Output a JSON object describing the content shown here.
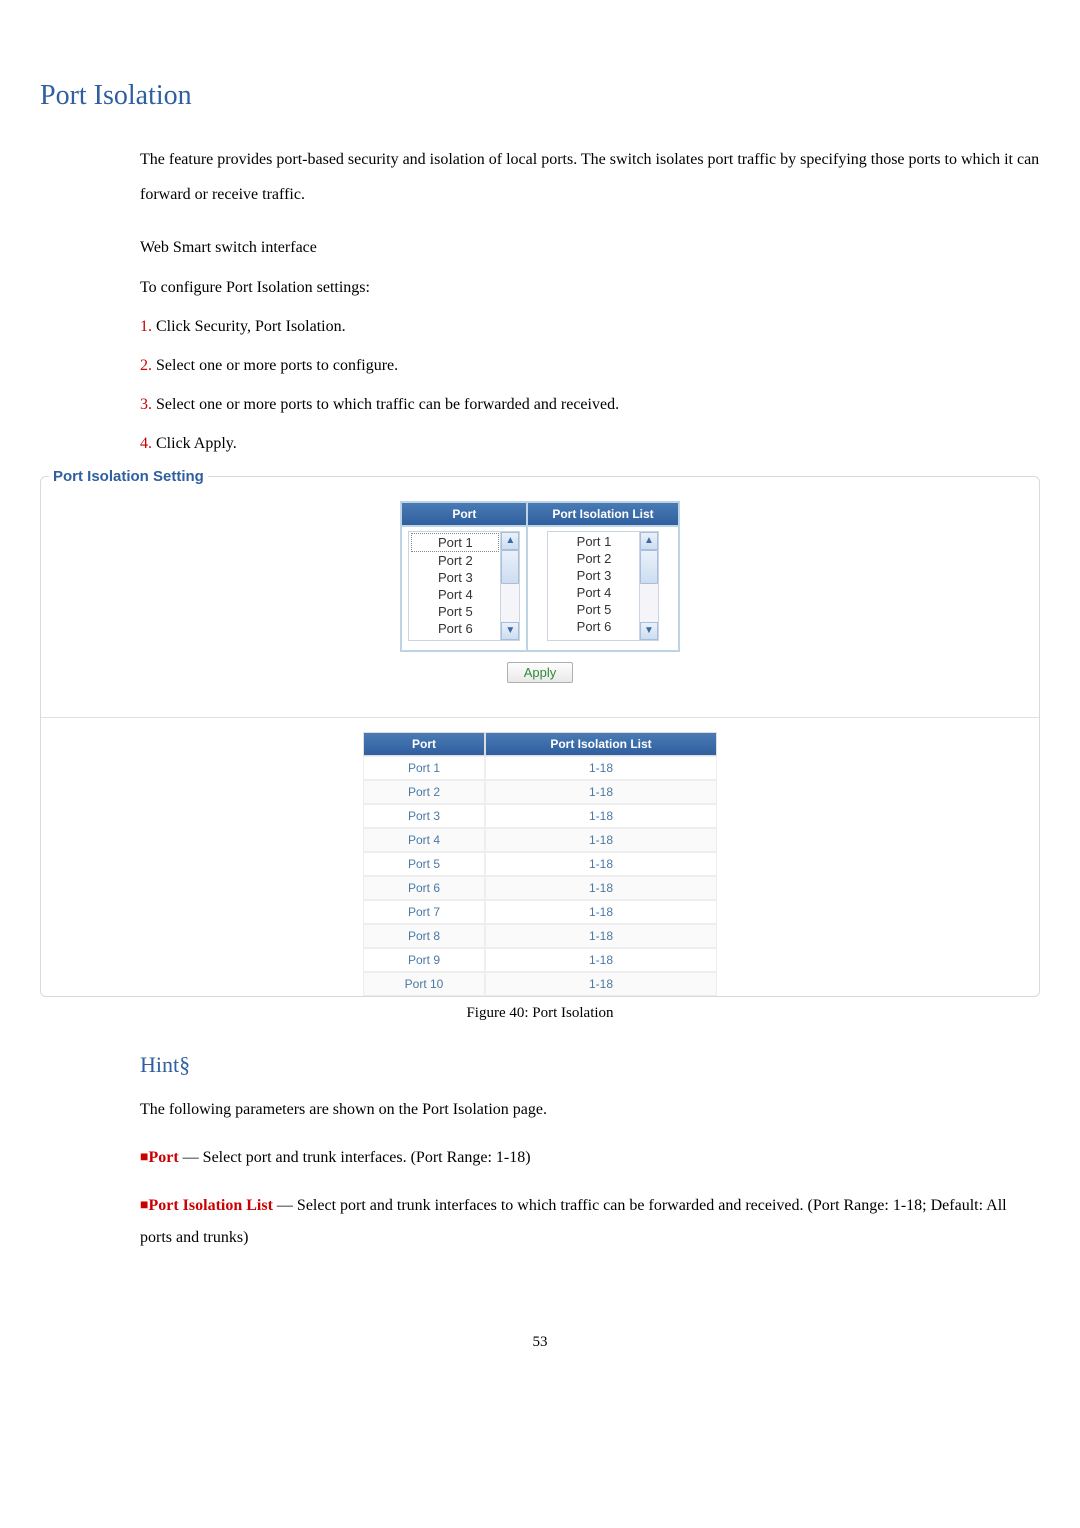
{
  "title": "Port Isolation",
  "intro1": "The feature provides port-based security and isolation of local ports. The switch isolates port traffic by specifying those ports to which it can forward or receive traffic.",
  "web_intf": "Web Smart switch interface",
  "config_line": "To configure Port Isolation settings:",
  "steps": [
    {
      "n": "1.",
      "t": " Click Security, Port Isolation."
    },
    {
      "n": "2.",
      "t": " Select one or more ports to configure."
    },
    {
      "n": "3.",
      "t": " Select one or more ports to which traffic can be forwarded and received."
    },
    {
      "n": "4.",
      "t": " Click Apply."
    }
  ],
  "legend": "Port Isolation Setting",
  "panel": {
    "col1": "Port",
    "col2": "Port Isolation List",
    "port_options": [
      "Port 1",
      "Port 2",
      "Port 3",
      "Port 4",
      "Port 5",
      "Port 6"
    ],
    "iso_options": [
      "Port 1",
      "Port 2",
      "Port 3",
      "Port 4",
      "Port 5",
      "Port 6"
    ],
    "apply": "Apply"
  },
  "results": {
    "h1": "Port",
    "h2": "Port Isolation List",
    "rows": [
      {
        "p": "Port 1",
        "v": "1-18"
      },
      {
        "p": "Port 2",
        "v": "1-18"
      },
      {
        "p": "Port 3",
        "v": "1-18"
      },
      {
        "p": "Port 4",
        "v": "1-18"
      },
      {
        "p": "Port 5",
        "v": "1-18"
      },
      {
        "p": "Port 6",
        "v": "1-18"
      },
      {
        "p": "Port 7",
        "v": "1-18"
      },
      {
        "p": "Port 8",
        "v": "1-18"
      },
      {
        "p": "Port 9",
        "v": "1-18"
      },
      {
        "p": "Port 10",
        "v": "1-18"
      }
    ]
  },
  "figure": "Figure 40: Port Isolation",
  "hint_title": "Hint§",
  "hint_intro": "The following parameters are shown on the Port Isolation page.",
  "hints": [
    {
      "term": "Port",
      "desc": " — Select port and trunk interfaces. (Port Range: 1-18)"
    },
    {
      "term": "Port Isolation List",
      "desc": " — Select port and trunk interfaces to which traffic can be forwarded and received. (Port Range: 1-18; Default: All ports and trunks)"
    }
  ],
  "pagenum": "53"
}
